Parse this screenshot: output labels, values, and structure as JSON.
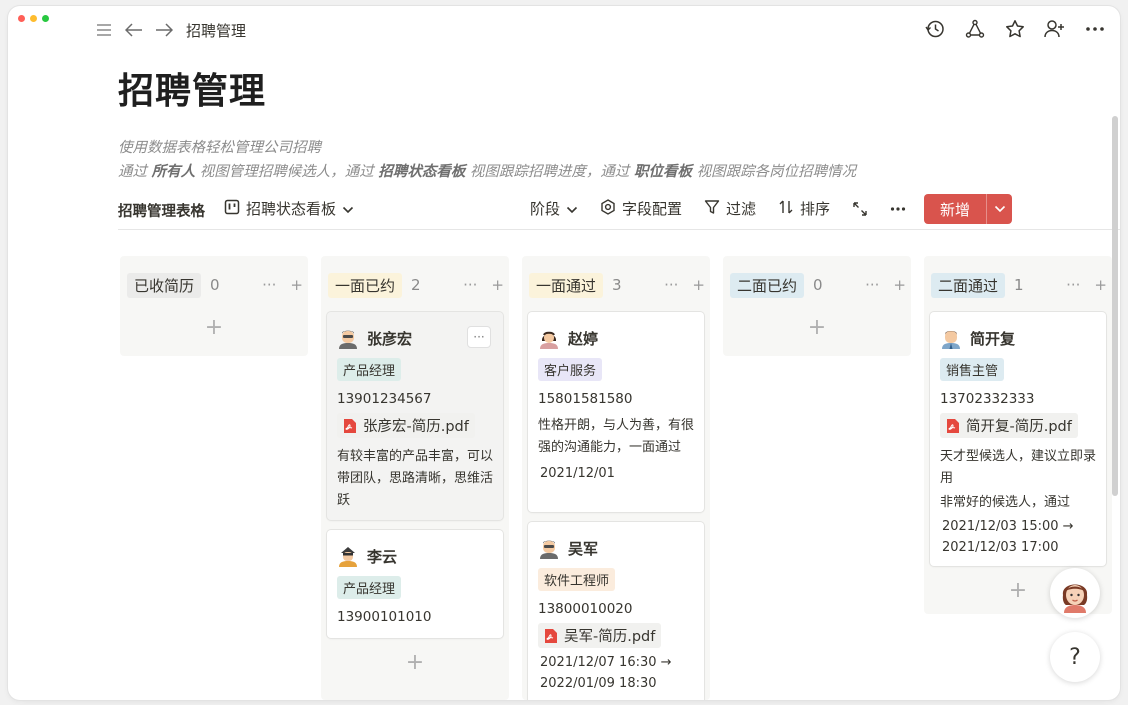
{
  "header": {
    "breadcrumb": "招聘管理"
  },
  "page": {
    "title": "招聘管理",
    "desc_line1": "使用数据表格轻松管理公司招聘",
    "desc_line2": {
      "p1": "通过 ",
      "b1": "所有人",
      "p2": " 视图管理招聘候选人，通过 ",
      "b2": "招聘状态看板",
      "p3": " 视图跟踪招聘进度，通过 ",
      "b3": "职位看板",
      "p4": " 视图跟踪各岗位招聘情况"
    }
  },
  "viewbar": {
    "database_name": "招聘管理表格",
    "current_view": "招聘状态看板",
    "tools": {
      "group": "阶段",
      "fields": "字段配置",
      "filter": "过滤",
      "sort": "排序"
    },
    "new_label": "新增"
  },
  "colors": {
    "accent": "#d9544d",
    "tag_gray": "#ebebea",
    "tag_yellow": "#fbf3db",
    "tag_blue": "#ddebf1",
    "role_green": "#ddedea",
    "role_purple": "#e8e6f7",
    "role_orange": "#fbecdd",
    "role_blue": "#ddebf1"
  },
  "columns": [
    {
      "label": "已收简历",
      "count": "0"
    },
    {
      "label": "一面已约",
      "count": "2"
    },
    {
      "label": "一面通过",
      "count": "3"
    },
    {
      "label": "二面已约",
      "count": "0"
    },
    {
      "label": "二面通过",
      "count": "1"
    }
  ],
  "cards": {
    "zhang": {
      "name": "张彦宏",
      "role": "产品经理",
      "phone": "13901234567",
      "file": "张彦宏-简历.pdf",
      "note": "有较丰富的产品丰富，可以带团队，思路清晰，思维活跃"
    },
    "li": {
      "name": "李云",
      "role": "产品经理",
      "phone": "13900101010"
    },
    "zhao": {
      "name": "赵婷",
      "role": "客户服务",
      "phone": "15801581580",
      "note": "性格开朗，与人为善，有很强的沟通能力，一面通过",
      "date": "2021/12/01"
    },
    "wu": {
      "name": "吴军",
      "role": "软件工程师",
      "phone": "13800010020",
      "file": "吴军-简历.pdf",
      "date": "2021/12/07 16:30 → 2022/01/09 18:30"
    },
    "jian": {
      "name": "简开复",
      "role": "销售主管",
      "phone": "13702332333",
      "file": "简开复-简历.pdf",
      "note": "天才型候选人，建议立即录用",
      "note2": "非常好的候选人，通过",
      "date": "2021/12/03 15:00 → 2021/12/03 17:00"
    }
  },
  "icons": {
    "menu": "menu-icon",
    "back": "arrow-left-icon",
    "forward": "arrow-right-icon",
    "history": "history-icon",
    "share": "share-nodes-icon",
    "star": "star-icon",
    "add_user": "add-user-icon",
    "more": "more-icon",
    "board": "board-view-icon",
    "pdf": "pdf-file-icon",
    "help": "help-icon"
  }
}
